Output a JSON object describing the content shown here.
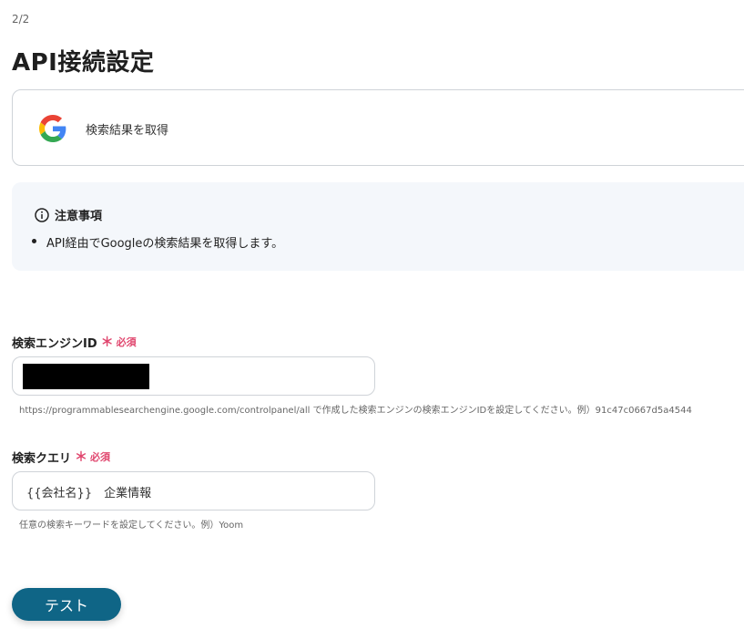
{
  "header": {
    "step": "2/2",
    "title": "API接続設定"
  },
  "action": {
    "icon": "google-icon",
    "label": "検索結果を取得"
  },
  "notice": {
    "icon": "info-icon",
    "title": "注意事項",
    "items": [
      "API経由でGoogleの検索結果を取得します。"
    ]
  },
  "fields": {
    "engine_id": {
      "label": "検索エンジンID",
      "required_mark": "＊",
      "required_text": "必須",
      "value_redacted": true,
      "hint": "https://programmablesearchengine.google.com/controlpanel/all で作成した検索エンジンの検索エンジンIDを設定してください。例）91c47c0667d5a4544"
    },
    "query": {
      "label": "検索クエリ",
      "required_mark": "＊",
      "required_text": "必須",
      "value": "{{会社名}}　企業情報",
      "hint": "任意の検索キーワードを設定してください。例）Yoom"
    }
  },
  "buttons": {
    "test_label": "テスト"
  },
  "colors": {
    "primary": "#0f6586",
    "required": "#e0466e",
    "notice_bg": "#f4f7fb",
    "border": "#cfd3d8"
  }
}
